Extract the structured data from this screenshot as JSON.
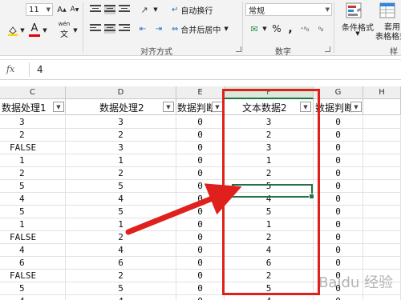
{
  "ribbon": {
    "font_size": "11",
    "font_color_icon": "A",
    "wrap_text": "自动换行",
    "merge_center": "合并后居中",
    "number_format": "常规",
    "percent": "%",
    "comma": ",",
    "cond_format": "条件格式",
    "table_format_1": "套用",
    "table_format_2": "表格格式",
    "styles_cut": "样式",
    "align_group": "对齐方式",
    "number_group": "数字",
    "wen_label": "wén"
  },
  "formula_bar": {
    "fx": "fx",
    "value": "4"
  },
  "columns": {
    "letters": [
      "C",
      "D",
      "E",
      "F",
      "G",
      "H"
    ],
    "headers": [
      "数据处理1",
      "数据处理2",
      "数据判断",
      "文本数据2",
      "数据判断",
      ""
    ]
  },
  "rows": [
    [
      "3",
      "3",
      "0",
      "3",
      "0"
    ],
    [
      "2",
      "2",
      "0",
      "2",
      "0"
    ],
    [
      "FALSE",
      "3",
      "0",
      "3",
      "0"
    ],
    [
      "1",
      "1",
      "0",
      "1",
      "0"
    ],
    [
      "2",
      "2",
      "0",
      "2",
      "0"
    ],
    [
      "5",
      "5",
      "0",
      "5",
      "0"
    ],
    [
      "4",
      "4",
      "0",
      "4",
      "0"
    ],
    [
      "5",
      "5",
      "0",
      "5",
      "0"
    ],
    [
      "1",
      "1",
      "0",
      "1",
      "0"
    ],
    [
      "FALSE",
      "2",
      "0",
      "2",
      "0"
    ],
    [
      "4",
      "4",
      "0",
      "4",
      "0"
    ],
    [
      "6",
      "6",
      "0",
      "6",
      "0"
    ],
    [
      "FALSE",
      "2",
      "0",
      "2",
      "0"
    ],
    [
      "5",
      "5",
      "0",
      "5",
      "0"
    ],
    [
      "4",
      "4",
      "0",
      "4",
      "0"
    ]
  ],
  "colors": {
    "annotation_red": "#e0201c",
    "excel_green": "#217346"
  },
  "watermark": "Baidu 经验"
}
